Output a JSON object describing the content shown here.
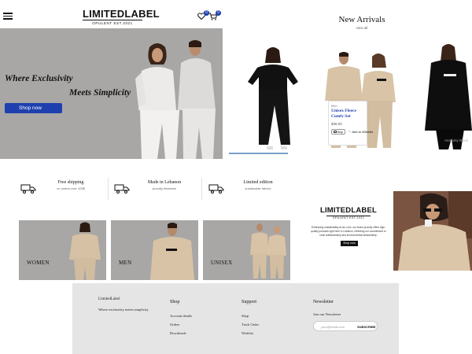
{
  "header": {
    "logo_title": "LIMITEDLABEL",
    "logo_tagline": "OPULENT EST.2021",
    "wishlist_count": "0",
    "cart_count": "0"
  },
  "hero": {
    "line1": "Where Exclusivity",
    "line2": "Meets Simplicity",
    "cta": "Shop now",
    "background": "#a8a7a6",
    "accent": "#1e40af"
  },
  "new_arrivals": {
    "title": "New Arrivals",
    "subtitle": "view all",
    "quick_card": {
      "category": "Men",
      "name": "Unisex Fleece Comfy Set",
      "price": "$36.00",
      "buy_label": "Buy",
      "wishlist_label": "Add to Wishlist"
    },
    "right_partial_text": "Anatomy Black"
  },
  "features": [
    {
      "title": "Free shipping",
      "subtitle": "on orders over 100$",
      "icon": "truck-icon"
    },
    {
      "title": "Made in Lebanon",
      "subtitle": "proudly lebanese",
      "icon": "truck-icon"
    },
    {
      "title": "Limited edition",
      "subtitle": "sustainable fabrics",
      "icon": "truck-icon"
    }
  ],
  "categories": [
    {
      "label": "WOMEN"
    },
    {
      "label": "MEN"
    },
    {
      "label": "UNISEX"
    }
  ],
  "brand_panel": {
    "logo_title": "LIMITEDLABEL",
    "logo_tagline": "OPULENT EST.2021",
    "description": "Embracing sustainability at our core, our brand proudly offers high-quality products right here in Lebanon, reflecting our commitment to local craftsmanship and environmental stewardship.",
    "cta": "Shop now"
  },
  "footer": {
    "brand_name": "LimitedLabel",
    "brand_tagline": "Where exclusivity meets simplicity",
    "shop": {
      "heading": "Shop",
      "links": [
        "Account details",
        "Orders",
        "Downloads"
      ]
    },
    "support": {
      "heading": "Support",
      "links": [
        "Shop",
        "Track Order",
        "Wishlist"
      ]
    },
    "newsletter": {
      "heading": "Newsletter",
      "text": "Join our Newsletter",
      "placeholder": "your@email.com",
      "button": "SUBSCRIBE"
    }
  }
}
